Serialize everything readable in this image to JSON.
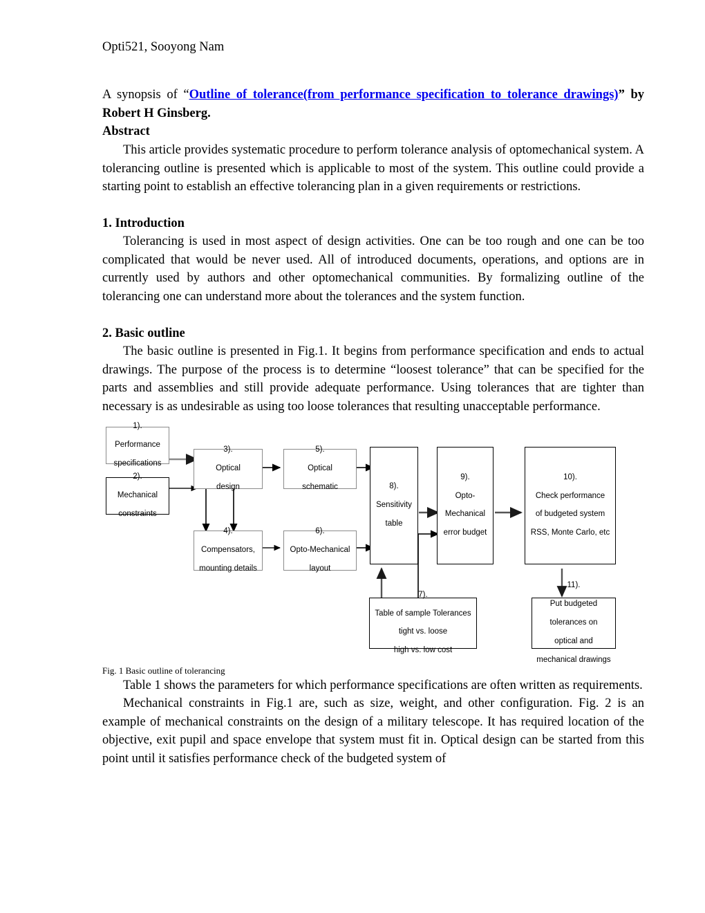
{
  "document": {
    "running_head": "Opti521, Sooyong Nam",
    "title_prefix": "A synopsis of “",
    "title_link": "Outline of tolerance(from performance specification to tolerance drawings)",
    "title_suffix": "” by Robert H Ginsberg.",
    "link_color": "#0000EE",
    "abstract_heading": "Abstract",
    "abstract_text": "This article provides systematic procedure to perform tolerance analysis of optomechanical system. A tolerancing outline is presented which is applicable to most of the system. This outline could provide a starting point to establish an effective tolerancing plan in a given requirements or restrictions.",
    "sections": [
      {
        "heading": "1. Introduction",
        "text": "Tolerancing is used in most aspect of design activities. One can be too rough and one can be too complicated that would be never used. All of introduced documents, operations, and options are in currently used by authors and other optomechanical communities. By formalizing outline of the tolerancing one can understand more about the tolerances and the system function."
      },
      {
        "heading": "2. Basic outline",
        "text": "The basic outline is presented in Fig.1. It begins from performance specification and ends to actual drawings. The purpose of the process is to determine “loosest tolerance” that can be specified for the parts and assemblies and still provide adequate performance. Using tolerances that are tighter than necessary is as undesirable as using too loose tolerances that resulting unacceptable performance."
      }
    ],
    "figure_caption": "Fig. 1 Basic outline of tolerancing",
    "paragraph_after_figure_1": "Table 1 shows the parameters for which performance specifications are often written as requirements.",
    "paragraph_after_figure_2": "Mechanical constraints in Fig.1 are, such as size, weight, and other configuration. Fig. 2 is an example of mechanical constraints on the design of a military telescope. It has required location of the objective, exit pupil and space envelope that system must fit in. Optical design can be started from this point until it satisfies performance check of the budgeted system of"
  },
  "figure": {
    "nodes": [
      {
        "id": "n1",
        "number": "1).",
        "lines": "Performance specifications"
      },
      {
        "id": "n2",
        "number": "2).",
        "lines": "Mechanical constraints"
      },
      {
        "id": "n3",
        "number": "3).",
        "lines": "Optical design"
      },
      {
        "id": "n4",
        "number": "4).",
        "lines": "Compensators, mounting details"
      },
      {
        "id": "n5",
        "number": "5).",
        "lines": "Optical schematic"
      },
      {
        "id": "n6",
        "number": "6).",
        "lines": "Opto-Mechanical layout"
      },
      {
        "id": "n7",
        "number": "7).",
        "lines": "Table of sample Tolerances tight vs. loose high vs. low cost"
      },
      {
        "id": "n8",
        "number": "8).",
        "lines": "Sensitivity table"
      },
      {
        "id": "n9",
        "number": "9).",
        "lines": "Opto-Mechanical error budget"
      },
      {
        "id": "n10",
        "number": "10).",
        "lines": "Check performance of budgeted system RSS, Monte Carlo, etc"
      },
      {
        "id": "n11",
        "number": "11).",
        "lines": "Put budgeted tolerances on optical and mechanical drawings"
      }
    ],
    "node_text": {
      "n1": [
        "1).",
        "Performance",
        "specifications"
      ],
      "n2": [
        "2).",
        "Mechanical",
        "constraints"
      ],
      "n3": [
        "3).",
        "Optical",
        "design"
      ],
      "n4": [
        "4).",
        "Compensators,",
        "mounting details"
      ],
      "n5": [
        "5).",
        "Optical",
        "schematic"
      ],
      "n6": [
        "6).",
        "Opto-Mechanical",
        "layout"
      ],
      "n7": [
        "7).",
        "Table of sample Tolerances",
        "tight vs. loose",
        "high vs. low cost"
      ],
      "n8": [
        "8).",
        "Sensitivity",
        "table"
      ],
      "n9": [
        "9).",
        "Opto-",
        "Mechanical",
        "error budget"
      ],
      "n10": [
        "10).",
        "Check performance",
        "of budgeted system",
        "RSS, Monte Carlo, etc"
      ],
      "n11": [
        "11).",
        "Put budgeted",
        "tolerances on",
        "optical and",
        "mechanical drawings"
      ]
    }
  }
}
